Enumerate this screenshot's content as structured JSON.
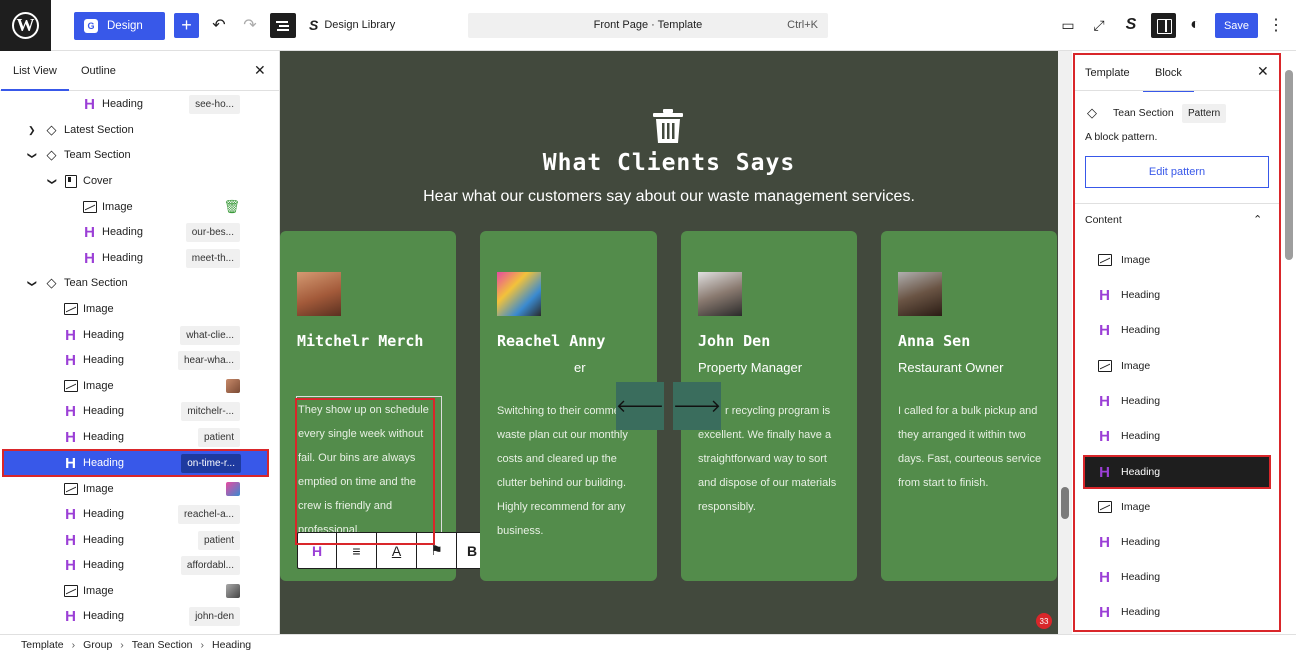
{
  "topbar": {
    "design_label": "Design",
    "design_library_label": "Design Library",
    "command_title": "Front Page · Template",
    "command_shortcut": "Ctrl+K",
    "save_label": "Save"
  },
  "left_panel": {
    "tabs": [
      "List View",
      "Outline"
    ],
    "rows": [
      {
        "label": "Heading",
        "tag": "see-ho..."
      },
      {
        "label": "Latest Section"
      },
      {
        "label": "Team Section"
      },
      {
        "label": "Cover"
      },
      {
        "label": "Image"
      },
      {
        "label": "Heading",
        "tag": "our-bes..."
      },
      {
        "label": "Heading",
        "tag": "meet-th..."
      },
      {
        "label": "Tean Section"
      },
      {
        "label": "Image"
      },
      {
        "label": "Heading",
        "tag": "what-clie..."
      },
      {
        "label": "Heading",
        "tag": "hear-wha..."
      },
      {
        "label": "Image"
      },
      {
        "label": "Heading",
        "tag": "mitchelr-..."
      },
      {
        "label": "Heading",
        "tag": "patient"
      },
      {
        "label": "Heading",
        "tag": "on-time-r..."
      },
      {
        "label": "Image"
      },
      {
        "label": "Heading",
        "tag": "reachel-a..."
      },
      {
        "label": "Heading",
        "tag": "patient"
      },
      {
        "label": "Heading",
        "tag": "affordabl..."
      },
      {
        "label": "Image"
      },
      {
        "label": "Heading",
        "tag": "john-den"
      }
    ]
  },
  "canvas": {
    "title": "What Clients Says",
    "subtitle": "Hear what our customers say about our waste management services.",
    "cards": [
      {
        "name": "Mitchelr Merch",
        "role": "",
        "quote": "They show up on schedule every single week without fail. Our bins are always emptied on time and the crew is friendly and professional."
      },
      {
        "name": "Reachel Anny",
        "role": "er",
        "quote": "Switching to their commercial waste plan cut our monthly costs and cleared up the clutter behind our building. Highly recommend for any business."
      },
      {
        "name": "John Den",
        "role": "Property Manager",
        "quote": "r recycling program is excellent. We finally have a straightforward way to sort and dispose of our materials responsibly."
      },
      {
        "name": "Anna Sen",
        "role": "Restaurant Owner",
        "quote": "I called for a bulk pickup and they arranged it within two days. Fast, courteous service from start to finish."
      }
    ],
    "notification_count": "33"
  },
  "right_panel": {
    "tabs": [
      "Template",
      "Block"
    ],
    "block_name": "Tean Section",
    "block_type": "Pattern",
    "description": "A block pattern.",
    "edit_label": "Edit pattern",
    "content_label": "Content",
    "content_items": [
      "Image",
      "Heading",
      "Heading",
      "Image",
      "Heading",
      "Heading",
      "Heading",
      "Image",
      "Heading",
      "Heading",
      "Heading"
    ]
  },
  "breadcrumb": [
    "Template",
    "Group",
    "Tean Section",
    "Heading"
  ],
  "colors": {
    "accent": "#3858e9",
    "canvas_bg": "#42493d",
    "card_bg": "#538c4b",
    "highlight": "#d9262a",
    "heading_icon": "#9b3fd6"
  }
}
